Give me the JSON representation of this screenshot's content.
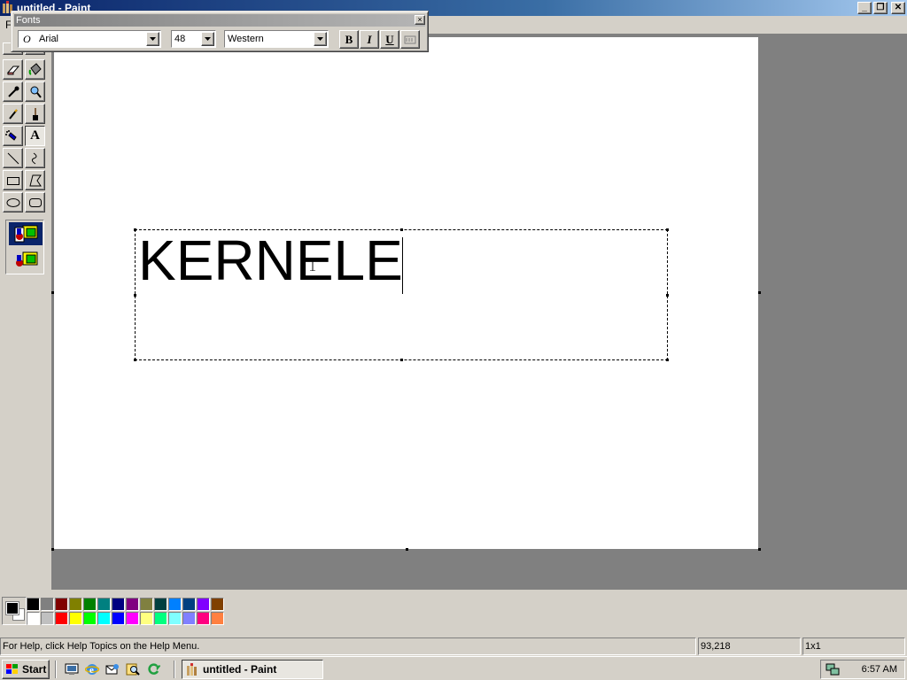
{
  "window": {
    "title": "untitled - Paint",
    "minimize_label": "_",
    "restore_label": "❐",
    "close_label": "✕"
  },
  "menu": {
    "first_letter": "F"
  },
  "fonts_toolbar": {
    "title": "Fonts",
    "close_label": "×",
    "font_name": "Arial",
    "font_size": "48",
    "script": "Western",
    "bold_label": "B",
    "italic_label": "I",
    "underline_label": "U"
  },
  "canvas": {
    "typed_text": "KERNELE"
  },
  "palette": {
    "foreground": "#000000",
    "background": "#ffffff",
    "row1": [
      "#000000",
      "#808080",
      "#800000",
      "#808000",
      "#008000",
      "#008080",
      "#000080",
      "#800080",
      "#808040",
      "#004040",
      "#0080ff",
      "#004080",
      "#8000ff",
      "#804000"
    ],
    "row2": [
      "#ffffff",
      "#c0c0c0",
      "#ff0000",
      "#ffff00",
      "#00ff00",
      "#00ffff",
      "#0000ff",
      "#ff00ff",
      "#ffff80",
      "#00ff80",
      "#80ffff",
      "#8080ff",
      "#ff0080",
      "#ff8040"
    ]
  },
  "statusbar": {
    "help_text": "For Help, click Help Topics on the Help Menu.",
    "coords": "93,218",
    "size": "1x1"
  },
  "taskbar": {
    "start_label": "Start",
    "task_label": "untitled - Paint",
    "clock": "6:57 AM"
  },
  "icons": {
    "tools": [
      "free-select-icon",
      "select-icon",
      "eraser-icon",
      "fill-icon",
      "color-picker-icon",
      "magnifier-icon",
      "pencil-icon",
      "brush-icon",
      "airbrush-icon",
      "text-icon",
      "line-icon",
      "curve-icon",
      "rectangle-icon",
      "polygon-icon",
      "ellipse-icon",
      "rounded-rectangle-icon"
    ]
  }
}
